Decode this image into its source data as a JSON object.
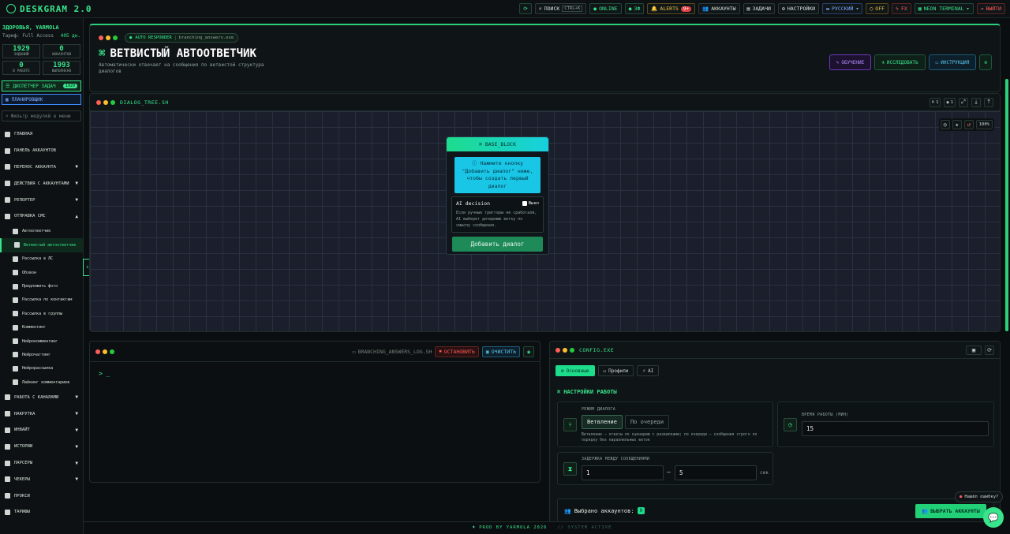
{
  "app": {
    "title": "DESKGRAM 2.0"
  },
  "topbar": {
    "search_label": "ПОИСК",
    "search_kbd": "CTRL+K",
    "online": "ONLINE",
    "bot": "ЗФ",
    "alerts": "ALERTS",
    "alerts_count": "9+",
    "accounts": "АККАУНТЫ",
    "tasks": "ЗАДАЧИ",
    "settings": "НАСТРОЙКИ",
    "language": "РУССКИЙ",
    "off": "OFF",
    "fx": "FX",
    "theme": "NEON TERMINAL",
    "logout": "ВЫЙТИ"
  },
  "sidebar": {
    "greeting": "ЗДОРОВЬЯ, YARMOLA",
    "tariff_label": "Тариф: Full Access",
    "tariff_days": "405 дн.",
    "stats": [
      {
        "value": "1929",
        "label": "заданий"
      },
      {
        "value": "0",
        "label": "аккаунтов"
      },
      {
        "value": "0",
        "label": "в работе"
      },
      {
        "value": "1993",
        "label": "выполнено"
      }
    ],
    "dispatcher": "ДИСПЕТЧЕР ЗАДАЧ",
    "dispatcher_count": "1929",
    "planner": "ПЛАНИРОВЩИК",
    "filter_placeholder": "Фильтр модулей в меню",
    "nav": [
      {
        "label": "ГЛАВНАЯ",
        "caret": ""
      },
      {
        "label": "ПАНЕЛЬ АККАУНТОВ",
        "caret": ""
      },
      {
        "label": "ПЕРЕНОС АККАУНТА",
        "caret": "▼"
      },
      {
        "label": "ДЕЙСТВИЯ С АККАУНТАМИ",
        "caret": "▼"
      },
      {
        "label": "РЕПОРТЕР",
        "caret": "▼"
      },
      {
        "label": "ОТПРАВКА СМС",
        "caret": "▲"
      }
    ],
    "sub": [
      "Автоответчик",
      "Ветвистый автоответчик",
      "Рассылка в ЛС",
      "Обзвон",
      "Предложить фото",
      "Рассылка по контактам",
      "Рассылка в группы",
      "Комментинг",
      "Нейрокомментинг",
      "Нейрочаттинг",
      "Нейрорассылка",
      "Лайкинг комментариев"
    ],
    "nav2": [
      {
        "label": "РАБОТА С КАНАЛАМИ",
        "caret": "▼"
      },
      {
        "label": "НАКРУТКА",
        "caret": "▼"
      },
      {
        "label": "ИНВАЙТ",
        "caret": "▼"
      },
      {
        "label": "ИСТОРИИ",
        "caret": "▼"
      },
      {
        "label": "ПАРСЕРЫ",
        "caret": "▼"
      },
      {
        "label": "ЧЕКЕРЫ",
        "caret": "▼"
      },
      {
        "label": "ПРОКСИ",
        "caret": ""
      },
      {
        "label": "ТАРИФЫ",
        "caret": ""
      }
    ]
  },
  "header": {
    "chip": "AUTO RESPONDER",
    "chip_file": "branching_answers.exe",
    "title": "ВЕТВИСТЫЙ АВТООТВЕТЧИК",
    "desc": "Автоматически отвечает на сообщения по ветвистой структура диалогов",
    "btn_learn": "ОБУЧЕНИЕ",
    "btn_research": "ИССЛЕДОВАТЬ",
    "btn_instruction": "ИНСТРУКЦИЯ"
  },
  "canvas": {
    "file": "DIALOG_TREE.SH",
    "count_nodes": "1",
    "count_views": "1",
    "zoom": "100%",
    "node": {
      "title": "BASE_BLOCK",
      "hint": "Нажмите кнопку \"Добавить диалог\" ниже, чтобы создать первый диалог",
      "ai_label": "AI decision",
      "ai_state": "Выкл",
      "ai_text": "Если ручные триггеры не сработали, AI выберет дочернюю ветку по смыслу сообщения.",
      "add_btn": "Добавить диалог"
    }
  },
  "log": {
    "file": "BRANCHING_ANSWERS_LOG.SH",
    "stop": "ОСТАНОВИТЬ",
    "clear": "ОЧИСТИТЬ",
    "prompt": "> _"
  },
  "config": {
    "file": "CONFIG.EXE",
    "tabs": [
      "Основные",
      "Профили",
      "AI"
    ],
    "section": "НАСТРОЙКИ РАБОТЫ",
    "mode_label": "РЕЖИМ ДИАЛОГА",
    "mode_opts": [
      "Ветвление",
      "По очереди"
    ],
    "mode_desc": "Ветвление — ответы по сценарию с развилками; по очереди — сообщения строго по порядку без параллельных веток",
    "time_label": "ВРЕМЯ РАБОТЫ (МИН)",
    "time_value": "15",
    "delay_label": "ЗАДЕРЖКА МЕЖДУ СООБЩЕНИЯМИ",
    "delay_from": "1",
    "delay_sep": "—",
    "delay_to": "5",
    "delay_unit": "сек",
    "selected_label": "Выбрано аккаунтов:",
    "selected_count": "0",
    "select_btn": "ВЫБРАТЬ АККАУНТЫ"
  },
  "footer": {
    "text": "PROD BY YARMOLA 2026",
    "status": "// SYSTEM ACTIVE"
  },
  "fab": {
    "found": "Нашёл ошибку?"
  }
}
